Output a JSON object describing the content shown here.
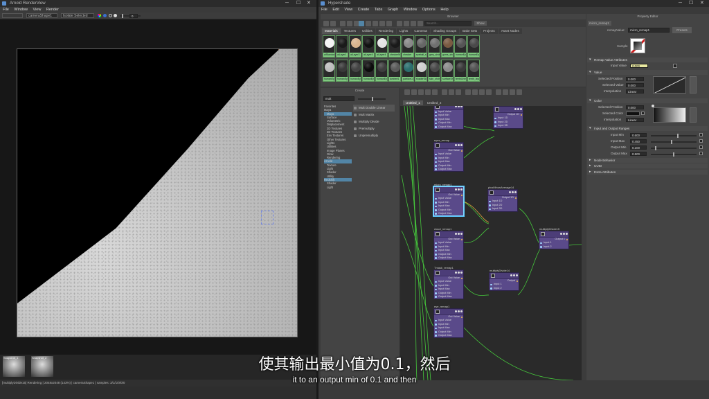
{
  "render_view": {
    "title": "Arnold RenderView",
    "menu": [
      "File",
      "Window",
      "View",
      "Render"
    ],
    "camera_select": "cameraShape1",
    "isolate_select": "Isolate Selected",
    "exposure_value": "0",
    "snapshots": [
      {
        "label": "Snapshot_1"
      },
      {
        "label": "Snapshot_2"
      }
    ],
    "status": "[multiplyDivide15] Rendering | 2048x2048 (143%) | cameraShape1 | samples: 3/1/1/0/0/0"
  },
  "hypershade": {
    "title": "Hypershade",
    "menu": [
      "File",
      "Edit",
      "View",
      "Create",
      "Tabs",
      "Graph",
      "Window",
      "Options",
      "Help"
    ],
    "browser": {
      "title": "Browser",
      "search_placeholder": "Search...",
      "show_label": "Show",
      "tabs": [
        "Materials",
        "Textures",
        "Utilities",
        "Rendering",
        "Lights",
        "Cameras",
        "Shading Groups",
        "Bake Sets",
        "Projects",
        "Asset Nodes"
      ],
      "swatches_row1": [
        {
          "label": "aiStandard1",
          "color": "#f4f4f4"
        },
        {
          "label": "aiLayer1",
          "color": "#1a1a1a"
        },
        {
          "label": "aiLayer3",
          "color": "#d9b48e"
        },
        {
          "label": "aiLayer4",
          "color": "#111111"
        },
        {
          "label": "aiLayer4",
          "color": "#e4e4e4"
        },
        {
          "label": "checkerMat",
          "color": "#1a1a1a"
        },
        {
          "label": "checker",
          "color": "#888888"
        },
        {
          "label": "eyeball_shdr",
          "color": "#666666"
        },
        {
          "label": "grey_shdr",
          "color": "#707070"
        },
        {
          "label": "gums_shdr",
          "color": "#7a5a42"
        },
        {
          "label": "humanEye",
          "color": "#555555"
        },
        {
          "label": "humanEye",
          "color": "#4a4a4a"
        }
      ],
      "swatches_row2": [
        {
          "label": "humanEye_...",
          "color": "#bdbdbd"
        },
        {
          "label": "humanEye_...",
          "color": "#3a3a3a"
        },
        {
          "label": "humanEye_...",
          "color": "#444444"
        },
        {
          "label": "humanEye_...",
          "color": "#0c0c0c"
        },
        {
          "label": "humanEye_...",
          "color": "#3f3f3f"
        },
        {
          "label": "lambert1",
          "color": "#5a5a5a"
        },
        {
          "label": "particleClo...",
          "color": "#2b6e6e"
        },
        {
          "label": "shaderGlow1",
          "color": "#cfcfcf"
        },
        {
          "label": "skin_shdr",
          "color": "#4a4a4a"
        },
        {
          "label": "surfaceSha...",
          "color": "#8a8a8a"
        },
        {
          "label": "teethGrime...",
          "color": "#3a3a3a"
        },
        {
          "label": "teeth_layer",
          "color": "#545454"
        }
      ]
    },
    "create": {
      "title": "Create",
      "search_value": "mult",
      "tree": [
        "Favorites",
        "Maya",
        "Maya",
        "Surface",
        "Volumetric",
        "Displacement",
        "2D Textures",
        "3D Textures",
        "Env Textures",
        "Other Textures",
        "Lights",
        "Utilities",
        "Image Planes",
        "Glow",
        "Rendering",
        "Arnold",
        "Texture",
        "Light",
        "Shader",
        "Utility",
        "Redshift",
        "Shader",
        "Light"
      ],
      "results": [
        "Mult Double Linear",
        "Mult Matrix",
        "Multiply Divide",
        "Premultiply",
        "Unpremultiply"
      ]
    },
    "graph": {
      "tabs": [
        "Untitled_1",
        "Untitled_2"
      ],
      "nodes": [
        {
          "id": "n0",
          "name": "",
          "rows_in": [
            "Input Value",
            "Input Min",
            "Input Max",
            "Output Min",
            "Output Max"
          ],
          "out": ""
        },
        {
          "id": "n1",
          "name": "eyes_remap",
          "rows_in": [
            "Input Value",
            "Input Min",
            "Input Max",
            "Output Min",
            "Output Max"
          ],
          "out": "Out Value"
        },
        {
          "id": "n2",
          "name": "micro_remap1",
          "rows_in": [
            "Input Value",
            "Input Min",
            "Input Max",
            "Output Min",
            "Output Max"
          ],
          "out": "Out Value"
        },
        {
          "id": "n3",
          "name": "cloud_remap1",
          "rows_in": [
            "Input Value",
            "Input Min",
            "Input Max",
            "Output Min",
            "Output Max"
          ],
          "out": "Out Value"
        },
        {
          "id": "n4",
          "name": "Tmask_remap1",
          "rows_in": [
            "Input Value",
            "Input Min",
            "Input Max",
            "Output Min",
            "Output Max"
          ],
          "out": "Out Value"
        },
        {
          "id": "n5",
          "name": "eye_remap1",
          "rows_in": [
            "Input Value",
            "Input Min",
            "Input Max",
            "Output Min",
            "Output Max"
          ],
          "out": "Out Value"
        },
        {
          "id": "n6",
          "name": "",
          "rows_in": [
            "Input 1D",
            "Input 2D",
            "Input 3D"
          ],
          "out": "Output 1D"
        },
        {
          "id": "n7",
          "name": "plusMinusAverage14",
          "rows_in": [
            "Input 1D",
            "Input 2D",
            "Input 3D"
          ],
          "out": "Output 1D"
        },
        {
          "id": "n8",
          "name": "multiplyDivide15",
          "rows_in": [
            "Input 1",
            "Input 2"
          ],
          "out": "Output 1"
        },
        {
          "id": "n9",
          "name": "multiplyDivide14",
          "rows_in": [
            "Input 1",
            "Input 2"
          ],
          "out": "Output"
        }
      ]
    }
  },
  "property_editor": {
    "title": "Property Editor",
    "node_name": "micro_remap1",
    "type_label": "remapValue:",
    "type_value": "micro_remap1",
    "presets_label": "Presets",
    "sample_label": "Sample",
    "sections": {
      "remap_attrs": "Remap Value Attributes",
      "value": "Value",
      "color": "Color",
      "io_ranges": "Input and Output Ranges",
      "node_behavior": "Node Behavior",
      "uuid": "UUID",
      "extra": "Extra Attributes"
    },
    "input_value": {
      "label": "Input Value",
      "value": "0.000"
    },
    "value_section": {
      "selected_position": {
        "label": "Selected Position",
        "value": "0.000"
      },
      "selected_value": {
        "label": "Selected Value",
        "value": "0.000"
      },
      "interpolation": {
        "label": "Interpolation",
        "value": "Linear"
      }
    },
    "color_section": {
      "selected_position": {
        "label": "Selected Position",
        "value": "0.000"
      },
      "selected_color": {
        "label": "Selected Color"
      },
      "interpolation": {
        "label": "Interpolation",
        "value": "Linear"
      }
    },
    "ranges": [
      {
        "label": "Input Min",
        "value": "0.600",
        "slider": 0.6
      },
      {
        "label": "Input Max",
        "value": "0.450",
        "slider": 0.45
      },
      {
        "label": "Output Min",
        "value": "0.100",
        "slider": 0.1
      },
      {
        "label": "Output Max",
        "value": "0.500",
        "slider": 0.5
      }
    ]
  },
  "subtitles": {
    "zh": "使其输出最小值为0.1，然后",
    "en": "it to an output min of 0.1 and then"
  }
}
